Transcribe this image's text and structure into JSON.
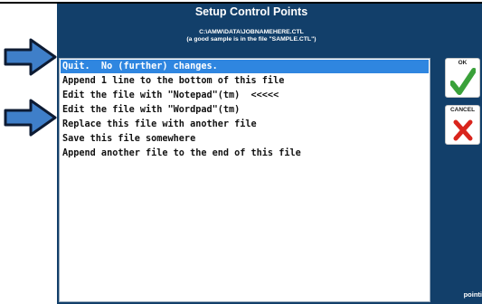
{
  "dialog": {
    "title": "Setup Control Points",
    "file_path": "C:\\AMW\\DATA\\JOBNAMEHERE.CTL",
    "sample_note": "(a good sample is in the file \"SAMPLE.CTL\")"
  },
  "options": [
    {
      "label": "Quit.  No (further) changes.",
      "selected": true
    },
    {
      "label": "Append 1 line to the bottom of this file",
      "selected": false
    },
    {
      "label": "Edit the file with \"Notepad\"(tm)  <<<<<",
      "selected": false
    },
    {
      "label": "Edit the file with \"Wordpad\"(tm)",
      "selected": false
    },
    {
      "label": "Replace this file with another file",
      "selected": false
    },
    {
      "label": "Save this file somewhere",
      "selected": false
    },
    {
      "label": "Append another file to the end of this file",
      "selected": false
    }
  ],
  "buttons": {
    "ok_label": "OK",
    "cancel_label": "CANCEL"
  },
  "status_text": "pointi",
  "colors": {
    "window_bg": "#123f6a",
    "selection": "#2f86e0",
    "arrow_fill": "#3f7fc9",
    "ok_check": "#3aa13a",
    "cancel_x": "#d9241c"
  }
}
